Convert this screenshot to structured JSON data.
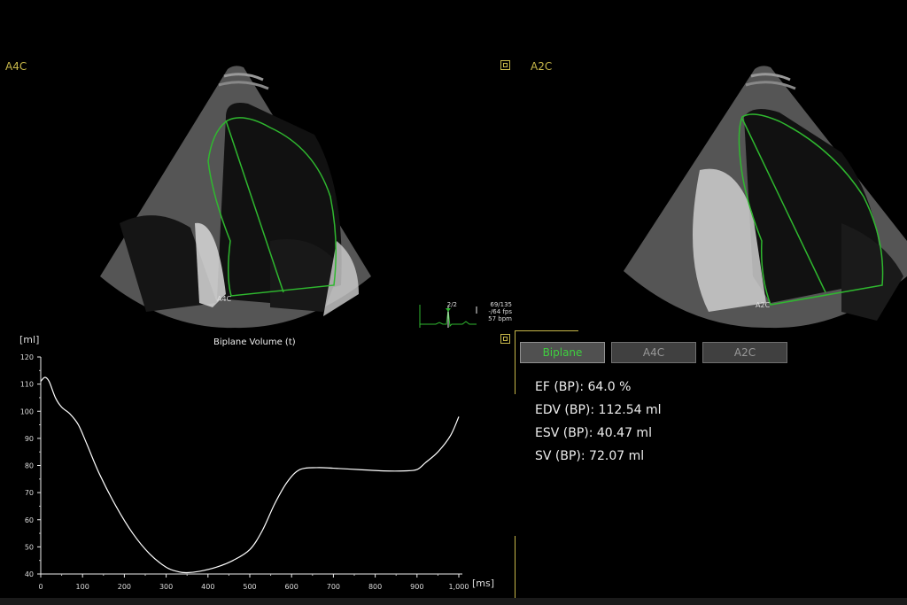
{
  "views": {
    "left_label": "A4C",
    "right_label": "A2C",
    "left_trace_marker": "A4C",
    "right_trace_marker": "A2C"
  },
  "ecg": {
    "frame_marker": "2/2",
    "frame_info": "69/135",
    "fps": "-/64 fps",
    "bpm": "57 bpm"
  },
  "tabs": [
    {
      "label": "Biplane",
      "active": true
    },
    {
      "label": "A4C",
      "active": false
    },
    {
      "label": "A2C",
      "active": false
    }
  ],
  "results": {
    "ef": "EF (BP): 64.0 %",
    "edv": "EDV (BP): 112.54 ml",
    "esv": "ESV (BP): 40.47 ml",
    "sv": "SV (BP): 72.07 ml"
  },
  "colors": {
    "accent_yellow": "#c8b84a",
    "trace_green": "#2fb82f",
    "active_tab_text": "#3fd03f",
    "curve": "#ffffff"
  },
  "icons": [
    "view-select-square-icon",
    "ecg-marker-icon"
  ],
  "chart_data": {
    "type": "line",
    "title": "Biplane Volume (t)",
    "ylabel": "[ml]",
    "xlabel": "[ms]",
    "xlim": [
      0,
      1000
    ],
    "ylim": [
      40,
      120
    ],
    "xticks": [
      0,
      100,
      200,
      300,
      400,
      500,
      600,
      700,
      800,
      900,
      "1,000"
    ],
    "yticks": [
      40,
      50,
      60,
      70,
      80,
      90,
      100,
      110,
      120
    ],
    "series": [
      {
        "x": [
          0,
          10,
          20,
          35,
          50,
          70,
          90,
          110,
          140,
          180,
          220,
          260,
          300,
          330,
          350,
          380,
          420,
          460,
          500,
          530,
          560,
          590,
          620,
          660,
          700,
          760,
          820,
          870,
          900,
          920,
          950,
          980,
          1000
        ],
        "values": [
          111,
          112.5,
          111,
          105,
          101.5,
          99,
          95,
          88,
          77,
          65,
          55,
          47.5,
          42.5,
          40.8,
          40.5,
          41,
          42.5,
          45,
          49,
          56,
          66,
          74,
          78.5,
          79.2,
          79,
          78.5,
          78,
          78,
          78.5,
          81,
          85,
          91,
          98
        ]
      }
    ]
  }
}
